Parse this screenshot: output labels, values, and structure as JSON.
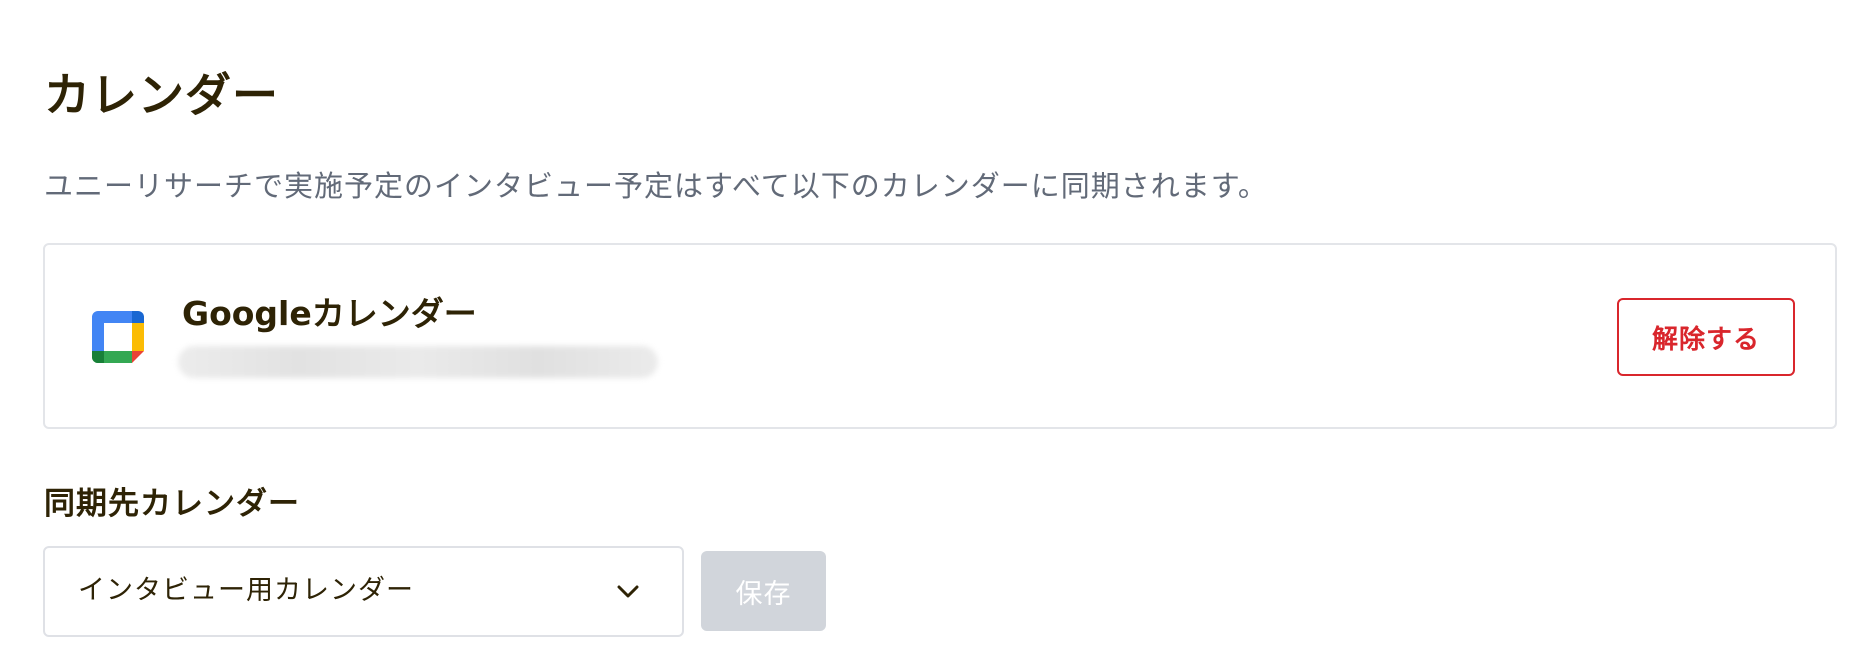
{
  "page": {
    "title": "カレンダー",
    "description": "ユニーリサーチで実施予定のインタビュー予定はすべて以下のカレンダーに同期されます。"
  },
  "connected_calendar": {
    "provider_name": "Googleカレンダー",
    "account_email": "",
    "icon": "google-calendar-icon",
    "disconnect_label": "解除する",
    "disconnect_color": "#d9262c"
  },
  "sync_target": {
    "label": "同期先カレンダー",
    "selected_value": "インタビュー用カレンダー",
    "save_label": "保存",
    "save_disabled": true
  },
  "colors": {
    "text_primary": "#2e2305",
    "text_secondary": "#626a78",
    "border": "#e3e5e9",
    "danger": "#d9262c",
    "button_disabled": "#d1d5db"
  }
}
